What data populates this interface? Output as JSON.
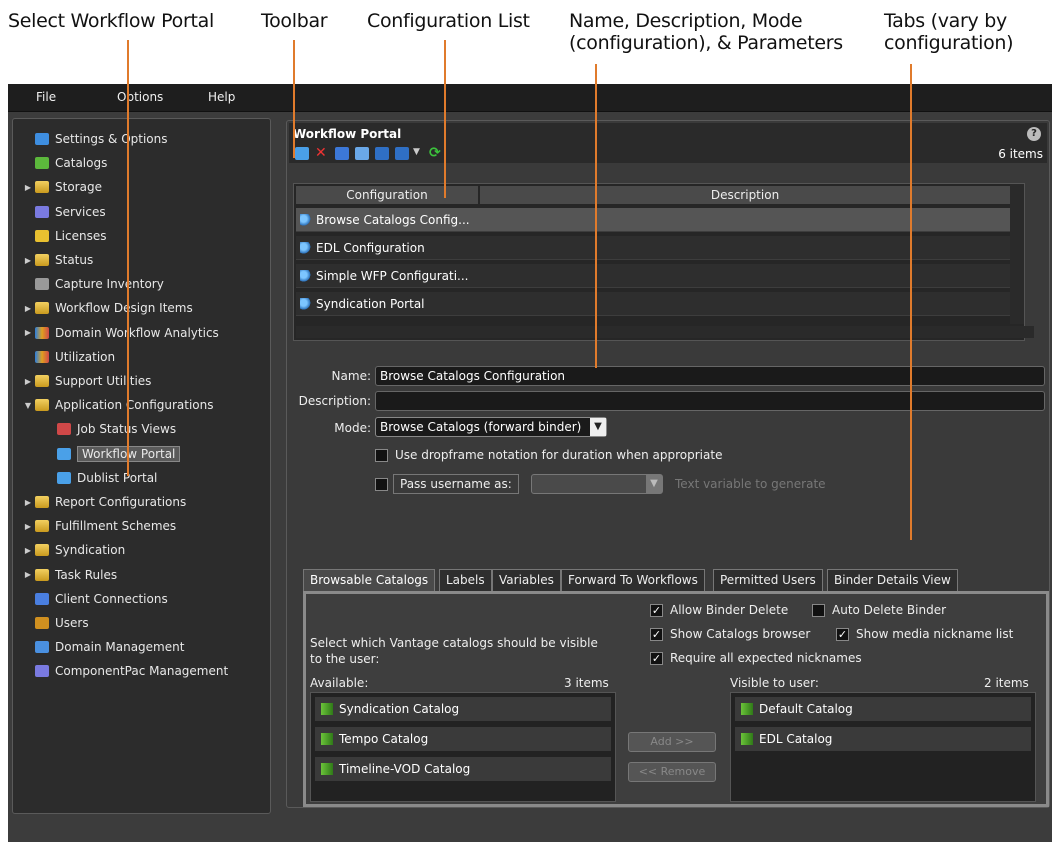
{
  "callouts": {
    "select_portal": "Select Workflow Portal",
    "toolbar": "Toolbar",
    "config_list": "Configuration List",
    "name_desc_line1": "Name, Description, Mode",
    "name_desc_line2": "(configuration), & Parameters",
    "tabs_line1": "Tabs (vary by",
    "tabs_line2": "configuration)"
  },
  "menu": {
    "file": "File",
    "options": "Options",
    "help": "Help"
  },
  "tree": [
    {
      "label": "Settings & Options",
      "expandable": false
    },
    {
      "label": "Catalogs",
      "expandable": false
    },
    {
      "label": "Storage",
      "expandable": true
    },
    {
      "label": "Services",
      "expandable": false
    },
    {
      "label": "Licenses",
      "expandable": false
    },
    {
      "label": "Status",
      "expandable": true
    },
    {
      "label": "Capture Inventory",
      "expandable": false
    },
    {
      "label": "Workflow Design Items",
      "expandable": true
    },
    {
      "label": "Domain Workflow Analytics",
      "expandable": true
    },
    {
      "label": "Utilization",
      "expandable": false
    },
    {
      "label": "Support Utilities",
      "expandable": true
    },
    {
      "label": "Application Configurations",
      "expandable": true
    },
    {
      "label": "Job Status Views",
      "expandable": false
    },
    {
      "label": "Workflow Portal",
      "expandable": false
    },
    {
      "label": "Dublist Portal",
      "expandable": false
    },
    {
      "label": "Report Configurations",
      "expandable": true
    },
    {
      "label": "Fulfillment Schemes",
      "expandable": true
    },
    {
      "label": "Syndication",
      "expandable": true
    },
    {
      "label": "Task Rules",
      "expandable": true
    },
    {
      "label": "Client Connections",
      "expandable": false
    },
    {
      "label": "Users",
      "expandable": false
    },
    {
      "label": "Domain Management",
      "expandable": false
    },
    {
      "label": "ComponentPac Management",
      "expandable": false
    }
  ],
  "panel": {
    "title": "Workflow Portal",
    "help": "?",
    "count": "6 items"
  },
  "grid": {
    "columns": [
      "Configuration",
      "Description"
    ],
    "rows": [
      "Browse Catalogs Config...",
      "EDL Configuration",
      "Simple WFP Configurati...",
      "Syndication Portal"
    ]
  },
  "form": {
    "name_label": "Name:",
    "name_value": "Browse Catalogs Configuration",
    "desc_label": "Description:",
    "desc_value": "",
    "mode_label": "Mode:",
    "mode_value": "Browse Catalogs (forward binder)",
    "dropframe": "Use dropframe notation for duration when appropriate",
    "pass_username": "Pass username as:",
    "text_var": "Text variable to generate"
  },
  "tabs": [
    "Browsable Catalogs",
    "Labels",
    "Variables",
    "Forward To Workflows",
    "Permitted Users",
    "Binder Details View"
  ],
  "browsable": {
    "allow_delete": "Allow Binder Delete",
    "auto_delete": "Auto Delete Binder",
    "show_browser": "Show Catalogs browser",
    "show_nickname": "Show media nickname list",
    "require_nicknames": "Require all expected nicknames",
    "select_text_1": "Select which Vantage catalogs should be visible",
    "select_text_2": "to the user:",
    "available_label": "Available:",
    "available_count": "3 items",
    "visible_label": "Visible to user:",
    "visible_count": "2 items",
    "available": [
      "Syndication Catalog",
      "Tempo Catalog",
      "Timeline-VOD Catalog"
    ],
    "visible": [
      "Default Catalog",
      "EDL Catalog"
    ],
    "add_btn": "Add >>",
    "remove_btn": "<< Remove"
  }
}
